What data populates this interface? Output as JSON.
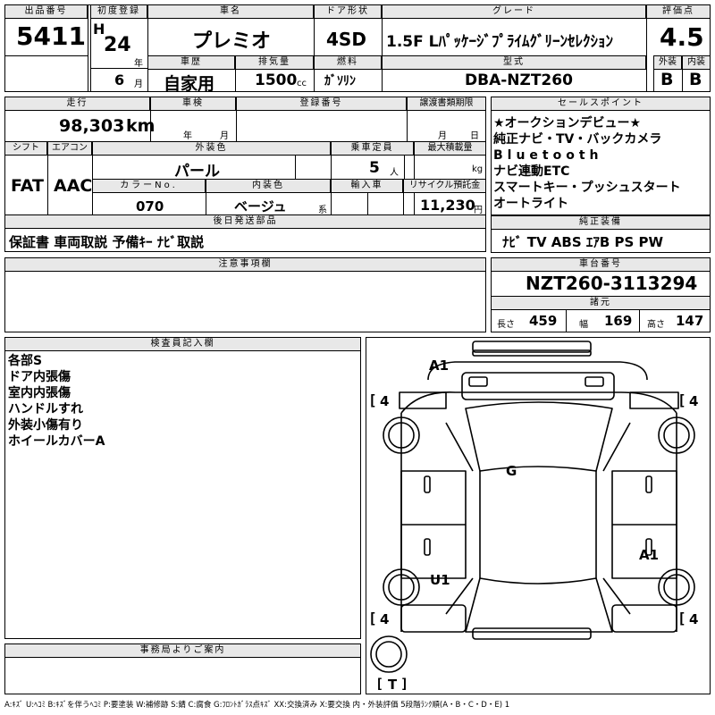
{
  "top": {
    "lot_no_label": "出品番号",
    "lot_no": "5411",
    "first_reg_label": "初度登録",
    "era": "H",
    "year": "24",
    "year_unit": "年",
    "month": "6",
    "month_unit": "月",
    "car_name_label": "車名",
    "car_name": "プレミオ",
    "history_label": "車歴",
    "history": "自家用",
    "displacement_label": "排気量",
    "displacement": "1500",
    "displacement_unit": "cc",
    "door_label": "ドア形状",
    "door": "4SD",
    "fuel_label": "燃料",
    "fuel": "ｶﾞｿﾘﾝ",
    "grade_label": "グレード",
    "grade": "1.5F Lﾊﾟｯｹｰｼﾞﾌﾟﾗｲﾑｸﾞﾘｰﾝｾﾚｸｼｮﾝ",
    "model_label": "型式",
    "model": "DBA-NZT260",
    "score_label": "評価点",
    "score": "4.5",
    "exterior_label": "外装",
    "exterior": "B",
    "interior_label": "内装",
    "interior": "B"
  },
  "mid": {
    "mileage_label": "走行",
    "mileage": "98,303",
    "mileage_unit": "km",
    "inspection_label": "車検",
    "inspection_year_unit": "年",
    "inspection_month_unit": "月",
    "reg_no_label": "登録番号",
    "transfer_label": "譲渡書類期限",
    "transfer_month_unit": "月",
    "transfer_day_unit": "日",
    "shift_label": "シフト",
    "shift": "FAT",
    "ac_label": "エアコン",
    "ac": "AAC",
    "ext_color_label": "外装色",
    "ext_color": "パール",
    "capacity_label": "乗車定員",
    "capacity": "5",
    "capacity_unit": "人",
    "max_load_label": "最大積載量",
    "max_load_unit": "kg",
    "color_no_label": "カラーNo.",
    "color_no": "070",
    "int_color_label": "内装色",
    "int_color": "ベージュ",
    "int_color_unit": "系",
    "import_label": "輸入車",
    "recycle_label": "リサイクル預託金",
    "recycle": "11,230",
    "recycle_unit": "円",
    "later_parts_label": "後日発送部品",
    "later_parts": "保証書 車両取説 予備ｷｰ ﾅﾋﾞ取説"
  },
  "sales": {
    "label": "セールスポイント",
    "lines": [
      "★オークションデビュー★",
      "純正ナビ・TV・バックカメラ",
      "Bluetooth",
      "ナビ連動ETC",
      "スマートキー・プッシュスタート",
      "オートライト"
    ]
  },
  "equipment": {
    "label": "純正装備",
    "value": "ﾅﾋﾞ TV ABS ｴｱB PS PW"
  },
  "caution": {
    "label": "注意事項欄"
  },
  "chassis": {
    "label": "車台番号",
    "value": "NZT260-3113294",
    "spec_label": "諸元",
    "length_label": "長さ",
    "length": "459",
    "width_label": "幅",
    "width": "169",
    "height_label": "高さ",
    "height": "147"
  },
  "inspector": {
    "label": "検査員記入欄",
    "lines": [
      "各部S",
      "ドア内張傷",
      "室内内張傷",
      "ハンドルすれ",
      "外装小傷有り",
      "ホイールカバーA"
    ]
  },
  "diagram": {
    "marks": {
      "front_bumper": "A1",
      "glass": "G",
      "rear_right_door": "A1",
      "rear_left_door": "U1"
    },
    "tires": {
      "front_left": "4",
      "front_right": "4",
      "rear_left": "4",
      "rear_right": "4",
      "spare": "T"
    }
  },
  "office": {
    "label": "事務局よりご案内"
  },
  "legend": "A:ｷｽﾞ U:ﾍｺﾐ B:ｷｽﾞを伴うﾍｺﾐ P:要塗装 W:補修跡 S:錆 C:腐食 G:ﾌﾛﾝﾄｶﾞﾗｽ点ｷｽﾞ XX:交換済み X:要交換 内・外装評価 5段階ﾗﾝｸ順(A・B・C・D・E) 1"
}
